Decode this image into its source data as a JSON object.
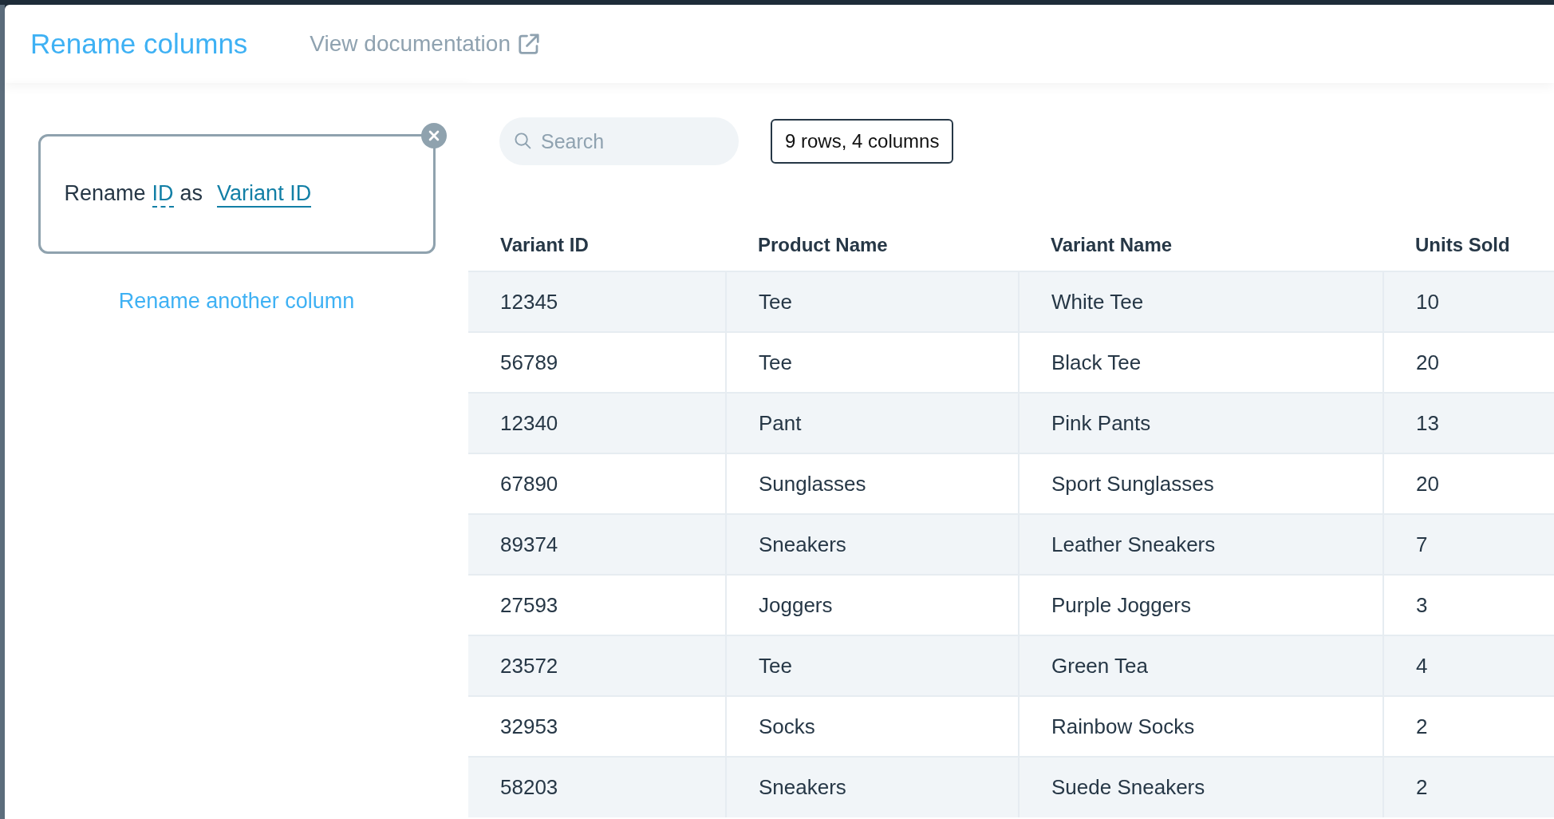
{
  "header": {
    "title": "Rename columns",
    "doc_link": "View documentation"
  },
  "renames": [
    {
      "prefix": "Rename",
      "from": "ID",
      "joiner": "as",
      "to": "Variant ID"
    }
  ],
  "add_link": "Rename another column",
  "search": {
    "placeholder": "Search"
  },
  "count_badge": "9 rows, 4 columns",
  "table": {
    "columns": [
      "Variant ID",
      "Product Name",
      "Variant Name",
      "Units Sold"
    ],
    "rows": [
      [
        "12345",
        "Tee",
        "White Tee",
        "10"
      ],
      [
        "56789",
        "Tee",
        "Black Tee",
        "20"
      ],
      [
        "12340",
        "Pant",
        "Pink Pants",
        "13"
      ],
      [
        "67890",
        "Sunglasses",
        "Sport Sunglasses",
        "20"
      ],
      [
        "89374",
        "Sneakers",
        "Leather Sneakers",
        "7"
      ],
      [
        "27593",
        "Joggers",
        "Purple Joggers",
        "3"
      ],
      [
        "23572",
        "Tee",
        "Green Tea",
        "4"
      ],
      [
        "32953",
        "Socks",
        "Rainbow Socks",
        "2"
      ],
      [
        "58203",
        "Sneakers",
        "Suede Sneakers",
        "2"
      ]
    ]
  }
}
